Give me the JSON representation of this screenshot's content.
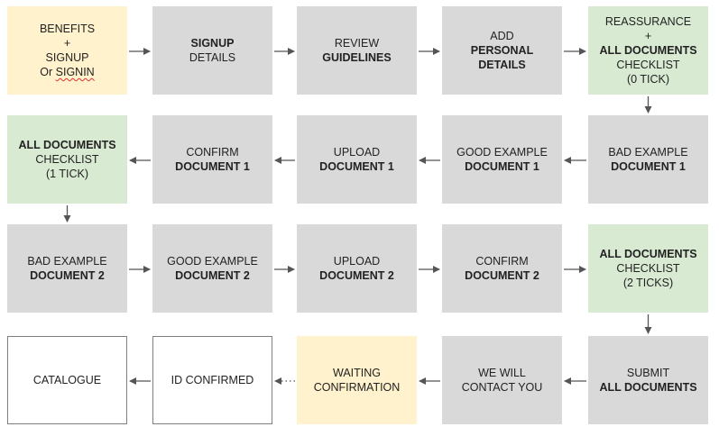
{
  "colors": {
    "gray": "#d9d9d9",
    "yellow": "#fff2cc",
    "green": "#d9ead3",
    "white": "#ffffff",
    "arrow": "#555555"
  },
  "nodes": [
    {
      "id": "benefits",
      "name": "node-benefits-signup",
      "color": "yellow",
      "lines": [
        {
          "text": "BENEFITS"
        },
        {
          "text": "+"
        },
        {
          "text": "SIGNUP"
        },
        {
          "text": "Or "
        },
        {
          "text": "SIGNIN",
          "squiggle": true
        }
      ]
    },
    {
      "id": "signup",
      "name": "node-signup-details",
      "color": "gray",
      "lines": [
        {
          "text": "SIGNUP",
          "bold": true
        },
        {
          "text": "DETAILS"
        }
      ]
    },
    {
      "id": "review",
      "name": "node-review-guidelines",
      "color": "gray",
      "lines": [
        {
          "text": "REVIEW"
        },
        {
          "text": "GUIDELINES",
          "bold": true
        }
      ]
    },
    {
      "id": "personal",
      "name": "node-add-personal-details",
      "color": "gray",
      "lines": [
        {
          "text": "ADD"
        },
        {
          "text": "PERSONAL",
          "bold": true
        },
        {
          "text": "DETAILS",
          "bold": true
        }
      ]
    },
    {
      "id": "reassure",
      "name": "node-reassurance-checklist",
      "color": "green",
      "lines": [
        {
          "text": "REASSURANCE"
        },
        {
          "text": "+"
        },
        {
          "text": "ALL DOCUMENTS",
          "bold": true
        },
        {
          "text": "CHECKLIST"
        },
        {
          "text": "(0 TICK)"
        }
      ]
    },
    {
      "id": "bad1",
      "name": "node-bad-example-doc1",
      "color": "gray",
      "lines": [
        {
          "text": "BAD EXAMPLE"
        },
        {
          "text": "DOCUMENT 1",
          "bold": true
        }
      ]
    },
    {
      "id": "good1",
      "name": "node-good-example-doc1",
      "color": "gray",
      "lines": [
        {
          "text": "GOOD EXAMPLE"
        },
        {
          "text": "DOCUMENT 1",
          "bold": true
        }
      ]
    },
    {
      "id": "upload1",
      "name": "node-upload-doc1",
      "color": "gray",
      "lines": [
        {
          "text": "UPLOAD"
        },
        {
          "text": "DOCUMENT 1",
          "bold": true
        }
      ]
    },
    {
      "id": "confirm1",
      "name": "node-confirm-doc1",
      "color": "gray",
      "lines": [
        {
          "text": "CONFIRM"
        },
        {
          "text": "DOCUMENT 1",
          "bold": true
        }
      ]
    },
    {
      "id": "check1",
      "name": "node-checklist-1-tick",
      "color": "green",
      "lines": [
        {
          "text": "ALL DOCUMENTS",
          "bold": true
        },
        {
          "text": "CHECKLIST"
        },
        {
          "text": "(1 TICK)"
        }
      ]
    },
    {
      "id": "bad2",
      "name": "node-bad-example-doc2",
      "color": "gray",
      "lines": [
        {
          "text": "BAD EXAMPLE"
        },
        {
          "text": "DOCUMENT 2",
          "bold": true
        }
      ]
    },
    {
      "id": "good2",
      "name": "node-good-example-doc2",
      "color": "gray",
      "lines": [
        {
          "text": "GOOD EXAMPLE"
        },
        {
          "text": "DOCUMENT 2",
          "bold": true
        }
      ]
    },
    {
      "id": "upload2",
      "name": "node-upload-doc2",
      "color": "gray",
      "lines": [
        {
          "text": "UPLOAD"
        },
        {
          "text": "DOCUMENT 2",
          "bold": true
        }
      ]
    },
    {
      "id": "confirm2",
      "name": "node-confirm-doc2",
      "color": "gray",
      "lines": [
        {
          "text": "CONFIRM"
        },
        {
          "text": "DOCUMENT 2",
          "bold": true
        }
      ]
    },
    {
      "id": "check2",
      "name": "node-checklist-2-ticks",
      "color": "green",
      "lines": [
        {
          "text": "ALL DOCUMENTS",
          "bold": true
        },
        {
          "text": "CHECKLIST"
        },
        {
          "text": "(2 TICKS)"
        }
      ]
    },
    {
      "id": "submit",
      "name": "node-submit-all-documents",
      "color": "gray",
      "lines": [
        {
          "text": "SUBMIT"
        },
        {
          "text": "ALL DOCUMENTS",
          "bold": true
        }
      ]
    },
    {
      "id": "contact",
      "name": "node-we-will-contact-you",
      "color": "gray",
      "lines": [
        {
          "text": "WE WILL"
        },
        {
          "text": "CONTACT YOU"
        }
      ]
    },
    {
      "id": "waiting",
      "name": "node-waiting-confirmation",
      "color": "yellow",
      "lines": [
        {
          "text": "WAITING"
        },
        {
          "text": "CONFIRMATION"
        }
      ]
    },
    {
      "id": "idconf",
      "name": "node-id-confirmed",
      "color": "white",
      "lines": [
        {
          "text": "ID CONFIRMED"
        }
      ]
    },
    {
      "id": "catalogue",
      "name": "node-catalogue",
      "color": "white",
      "lines": [
        {
          "text": "CATALOGUE"
        }
      ]
    }
  ],
  "edges": [
    {
      "from": "benefits",
      "to": "signup"
    },
    {
      "from": "signup",
      "to": "review"
    },
    {
      "from": "review",
      "to": "personal"
    },
    {
      "from": "personal",
      "to": "reassure"
    },
    {
      "from": "reassure",
      "to": "bad1"
    },
    {
      "from": "bad1",
      "to": "good1"
    },
    {
      "from": "good1",
      "to": "upload1"
    },
    {
      "from": "upload1",
      "to": "confirm1"
    },
    {
      "from": "confirm1",
      "to": "check1"
    },
    {
      "from": "check1",
      "to": "bad2"
    },
    {
      "from": "bad2",
      "to": "good2"
    },
    {
      "from": "good2",
      "to": "upload2"
    },
    {
      "from": "upload2",
      "to": "confirm2"
    },
    {
      "from": "confirm2",
      "to": "check2"
    },
    {
      "from": "check2",
      "to": "submit"
    },
    {
      "from": "submit",
      "to": "contact"
    },
    {
      "from": "contact",
      "to": "waiting"
    },
    {
      "from": "waiting",
      "to": "idconf",
      "dashed": true
    },
    {
      "from": "idconf",
      "to": "catalogue"
    }
  ]
}
